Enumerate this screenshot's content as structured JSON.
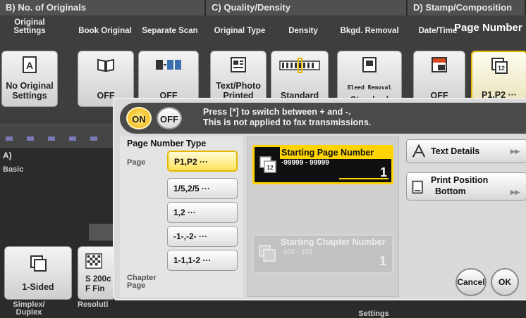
{
  "sections": {
    "b": "B)  No. of Originals",
    "c": "C)  Quality/Density",
    "d": "D)  Stamp/Composition",
    "a": "A)",
    "a_sub": "Basic"
  },
  "columns": {
    "original_settings": "Original Settings",
    "book_original": "Book Original",
    "separate_scan": "Separate Scan",
    "original_type": "Original Type",
    "density": "Density",
    "bkgd_removal": "Bkgd. Removal",
    "date_time": "Date/Time",
    "page_number": "Page Number"
  },
  "tiles": {
    "no_original_settings": "No Original Settings",
    "book_original_off": "OFF",
    "separate_scan_off": "OFF",
    "text_photo_printed": "Text/Photo Printed",
    "density_standard": "Standard",
    "bleed_removal_icon_text": "Bleed Removal",
    "bkgd_standard": "Standard",
    "date_time_off": "OFF",
    "page_number_val": "P1,P2 ···"
  },
  "bottom": {
    "one_sided": "1-Sided",
    "resolution_val_1": "S 200c",
    "resolution_val_2": "F Fin",
    "simplex_duplex": "Simplex/ Duplex",
    "resolution": "Resoluti",
    "settings": "Settings"
  },
  "toggle": {
    "on": "ON",
    "off": "OFF",
    "hint_line1": "Press [*] to switch between + and -.",
    "hint_line2": "This is not applied to fax transmissions."
  },
  "page_number_type": {
    "title": "Page Number Type",
    "page_label": "Page",
    "chapter_label": "Chapter Page",
    "options": [
      "P1,P2 ···",
      "1/5,2/5 ···",
      "1,2 ···",
      "-1-,-2- ···",
      "1-1,1-2 ···"
    ],
    "selected": "P1,P2 ···"
  },
  "starting_page": {
    "title": "Starting Page Number",
    "range": "-99999 - 99999",
    "value": "1"
  },
  "starting_chapter": {
    "title": "Starting Chapter Number",
    "range": "-100 - 100",
    "value": "1"
  },
  "side_buttons": {
    "text_details": "Text Details",
    "print_position_line1": "Print Position",
    "print_position_line2": "Bottom"
  },
  "actions": {
    "cancel": "Cancel",
    "ok": "OK"
  },
  "colors": {
    "accent_yellow": "#ffd400",
    "selection_yellow": "#ffe35a",
    "panel_gray": "#dadada",
    "dark_bar": "#4a4a4a"
  }
}
